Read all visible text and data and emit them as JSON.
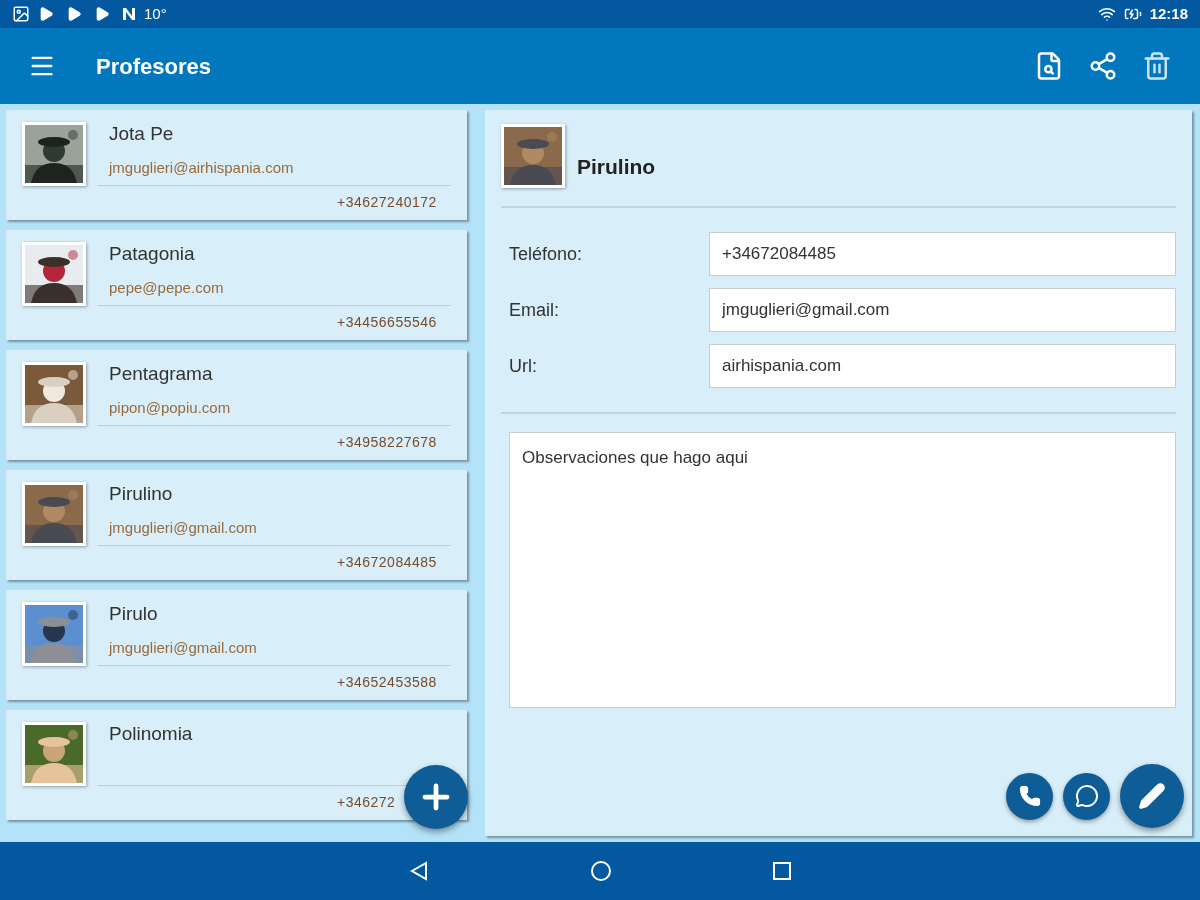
{
  "status_bar": {
    "temperature": "10°",
    "time": "12:18"
  },
  "app_bar": {
    "title": "Profesores"
  },
  "contacts": [
    {
      "name": "Jota Pe",
      "email": "jmguglieri@airhispania.com",
      "phone": "+34627240172"
    },
    {
      "name": "Patagonia",
      "email": "pepe@pepe.com",
      "phone": "+34456655546"
    },
    {
      "name": "Pentagrama",
      "email": "pipon@popiu.com",
      "phone": "+34958227678"
    },
    {
      "name": "Pirulino",
      "email": "jmguglieri@gmail.com",
      "phone": "+34672084485"
    },
    {
      "name": "Pirulo",
      "email": "jmguglieri@gmail.com",
      "phone": "+34652453588"
    },
    {
      "name": "Polinomia",
      "phone": "+346272"
    }
  ],
  "detail": {
    "name": "Pirulino",
    "fields": [
      {
        "label": "Teléfono:",
        "value": "+34672084485"
      },
      {
        "label": "Email:",
        "value": "jmguglieri@gmail.com"
      },
      {
        "label": "Url:",
        "value": "airhispania.com"
      }
    ],
    "notes": "Observaciones que hago aqui"
  }
}
